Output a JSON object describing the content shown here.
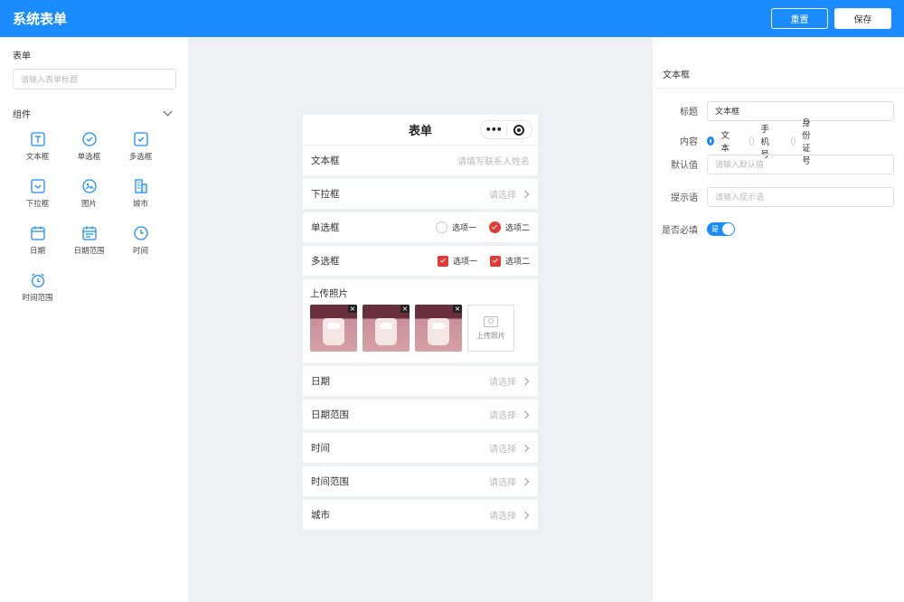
{
  "header": {
    "title": "系统表单",
    "reset_label": "重置",
    "save_label": "保存"
  },
  "left": {
    "form_label": "表单",
    "title_placeholder": "请输入表单标题",
    "components_label": "组件",
    "components": [
      {
        "label": "文本框",
        "icon": "text-box-icon"
      },
      {
        "label": "单选框",
        "icon": "radio-icon"
      },
      {
        "label": "多选框",
        "icon": "checkbox-icon"
      },
      {
        "label": "下拉框",
        "icon": "dropdown-icon"
      },
      {
        "label": "图片",
        "icon": "image-icon"
      },
      {
        "label": "城市",
        "icon": "city-icon"
      },
      {
        "label": "日期",
        "icon": "calendar-icon"
      },
      {
        "label": "日期范围",
        "icon": "date-range-icon"
      },
      {
        "label": "时间",
        "icon": "clock-icon"
      },
      {
        "label": "时间范围",
        "icon": "alarm-icon"
      }
    ]
  },
  "preview": {
    "title": "表单",
    "capsule_dots": "•••",
    "rows": {
      "text": {
        "label": "文本框",
        "placeholder": "请填写联系人姓名"
      },
      "select": {
        "label": "下拉框",
        "placeholder": "请选择"
      },
      "radio": {
        "label": "单选框",
        "options": [
          "选项一",
          "选项二"
        ],
        "selected": 1
      },
      "checkbox": {
        "label": "多选框",
        "options": [
          "选项一",
          "选项二"
        ],
        "checked": [
          0,
          1
        ]
      },
      "upload": {
        "label": "上传照片",
        "button_label": "上传照片",
        "photo_count": 3,
        "remove_label": "×"
      },
      "date": {
        "label": "日期",
        "placeholder": "请选择"
      },
      "date_range": {
        "label": "日期范围",
        "placeholder": "请选择"
      },
      "time": {
        "label": "时间",
        "placeholder": "请选择"
      },
      "time_range": {
        "label": "时间范围",
        "placeholder": "请选择"
      },
      "city": {
        "label": "城市",
        "placeholder": "请选择"
      }
    }
  },
  "right": {
    "panel_title": "文本框",
    "title_label": "标题",
    "title_value": "文本框",
    "content_label": "内容",
    "content_options": [
      "文本",
      "手机号",
      "身份证号"
    ],
    "content_selected": 0,
    "default_label": "默认值",
    "default_placeholder": "请输入默认值",
    "hint_label": "提示语",
    "hint_placeholder": "请输入提示语",
    "required_label": "是否必填",
    "required_switch_text": "是",
    "required": true,
    "accent_color": "#1a8cff"
  }
}
